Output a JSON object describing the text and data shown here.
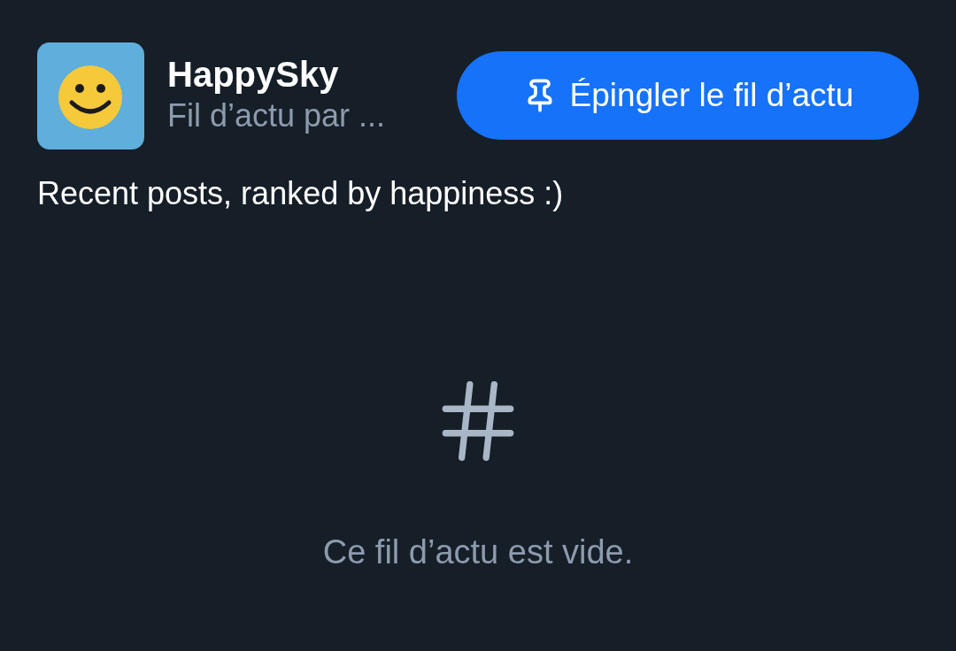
{
  "feed": {
    "name": "HappySky",
    "subtitle": "Fil d’actu par ...",
    "description": "Recent posts, ranked by happiness :)"
  },
  "pin_button": {
    "label": "Épingler le fil d’actu"
  },
  "empty_state": {
    "message": "Ce fil d’actu est vide."
  }
}
